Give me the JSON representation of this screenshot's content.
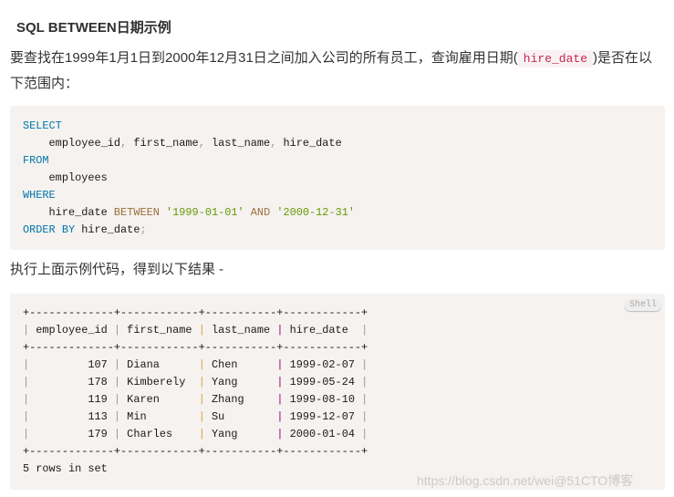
{
  "heading": "SQL BETWEEN日期示例",
  "intro": {
    "before": "要查找在1999年1月1日到2000年12月31日之间加入公司的所有员工，查询雇用日期(",
    "code": "hire_date",
    "after": ")是否在以下范围内："
  },
  "sql": {
    "select": "SELECT",
    "columns": "employee_id, first_name, last_name, hire_date",
    "from": "FROM",
    "table": "employees",
    "where": "WHERE",
    "col": "hire_date",
    "between": "BETWEEN",
    "start": "'1999-01-01'",
    "and": "AND",
    "end": "'2000-12-31'",
    "order_by": "ORDER BY",
    "order_col": "hire_date"
  },
  "result_intro": "执行上面示例代码，得到以下结果 -",
  "result": {
    "badge": "Shell",
    "border": "+-------------+------------+-----------+------------+",
    "headers": [
      "employee_id",
      "first_name",
      "last_name",
      "hire_date"
    ],
    "rows": [
      [
        "107",
        "Diana",
        "Chen",
        "1999-02-07"
      ],
      [
        "178",
        "Kimberely",
        "Yang",
        "1999-05-24"
      ],
      [
        "119",
        "Karen",
        "Zhang",
        "1999-08-10"
      ],
      [
        "113",
        "Min",
        "Su",
        "1999-12-07"
      ],
      [
        "179",
        "Charles",
        "Yang",
        "2000-01-04"
      ]
    ],
    "footer": "5 rows in set"
  },
  "watermark": "https://blog.csdn.net/wei@51CTO博客"
}
